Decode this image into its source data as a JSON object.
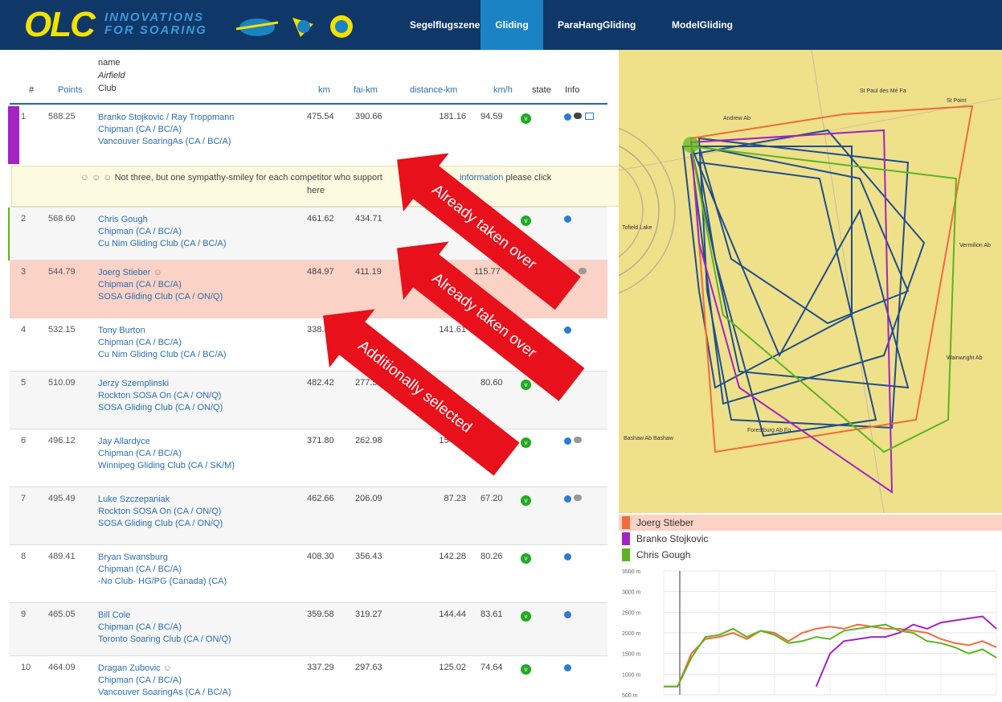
{
  "header": {
    "logo_text": "OLC",
    "tagline_1": "INNOVATIONS",
    "tagline_2": "FOR SOARING",
    "nav": [
      "Segelflugszene",
      "Gliding",
      "ParaHangGliding",
      "ModelGliding"
    ],
    "active_nav": "Gliding"
  },
  "table": {
    "col_rank": "#",
    "col_points": "Points",
    "col_name_1": "name",
    "col_name_2": "Airfield",
    "col_name_3": "Club",
    "col_km": "km",
    "col_fai": "fai-km",
    "col_dist": "distance-km",
    "col_kmh": "km/h",
    "col_state": "state",
    "col_info": "Info",
    "rows": [
      {
        "rank": "1",
        "points": "588.25",
        "name": "Branko Stojkovic / Ray Troppmann",
        "airfield": "Chipman (CA / BC/A)",
        "club": "Vancouver SoaringAs (CA / BC/A)",
        "km": "475.54",
        "fai": "390.66",
        "dist": "181.16",
        "kmh": "94.59"
      },
      {
        "rank": "2",
        "points": "568.60",
        "name": "Chris Gough",
        "airfield": "Chipman (CA / BC/A)",
        "club": "Cu Nim Gliding Club (CA / BC/A)",
        "km": "461.62",
        "fai": "434.71",
        "dist": "168",
        "kmh": ""
      },
      {
        "rank": "3",
        "points": "544.79",
        "name": "Joerg Stieber",
        "airfield": "Chipman (CA / BC/A)",
        "club": "SOSA Gliding Club (CA / ON/Q)",
        "km": "484.97",
        "fai": "411.19",
        "dist": "",
        "kmh": "115.77"
      },
      {
        "rank": "4",
        "points": "532.15",
        "name": "Tony Burton",
        "airfield": "Chipman (CA / BC/A)",
        "club": "Cu Nim Gliding Club (CA / BC/A)",
        "km": "338.49",
        "fai": "",
        "dist": "141.61",
        "kmh": ""
      },
      {
        "rank": "5",
        "points": "510.09",
        "name": "Jerzy Szemplinski",
        "airfield": "Rockton SOSA On (CA / ON/Q)",
        "club": "SOSA Gliding Club (CA / ON/Q)",
        "km": "482.42",
        "fai": "277.53",
        "dist": "",
        "kmh": "80.60"
      },
      {
        "rank": "6",
        "points": "496.12",
        "name": "Jay Allardyce",
        "airfield": "Chipman (CA / BC/A)",
        "club": "Winnipeg Gliding Club (CA / SK/M)",
        "km": "371.80",
        "fai": "262.98",
        "dist": "154.76",
        "kmh": ""
      },
      {
        "rank": "7",
        "points": "495.49",
        "name": "Luke Szczepaniak",
        "airfield": "Rockton SOSA On (CA / ON/Q)",
        "club": "SOSA Gliding Club (CA / ON/Q)",
        "km": "462.66",
        "fai": "206.09",
        "dist": "87.23",
        "kmh": "67.20"
      },
      {
        "rank": "8",
        "points": "489.41",
        "name": "Bryan Swansburg",
        "airfield": "Chipman (CA / BC/A)",
        "club": "-No Club- HG/PG (Canada) (CA)",
        "km": "408.30",
        "fai": "356.43",
        "dist": "142.28",
        "kmh": "80.26"
      },
      {
        "rank": "9",
        "points": "465.05",
        "name": "Bill Cole",
        "airfield": "Chipman (CA / BC/A)",
        "club": "Toronto Soaring Club (CA / ON/Q)",
        "km": "359.58",
        "fai": "319.27",
        "dist": "144.44",
        "kmh": "83.61"
      },
      {
        "rank": "10",
        "points": "464.09",
        "name": "Dragan Zubovic",
        "airfield": "Chipman (CA / BC/A)",
        "club": "Vancouver SoaringAs (CA / BC/A)",
        "km": "337.29",
        "fai": "297.63",
        "dist": "125.02",
        "kmh": "74.64"
      }
    ],
    "state_glyph": "v",
    "notice_prefix": "Not three, but one sympathy-smiley for each competitor who support",
    "notice_link": "information",
    "notice_suffix": "please click",
    "notice_tail": "here"
  },
  "annotations": {
    "arrow_1": "Already taken over",
    "arrow_2": "Already taken over",
    "arrow_3": "Additionally selected"
  },
  "map": {
    "places": [
      "St Paul des Mé Fa",
      "St Point",
      "Andrew Ab",
      "Vermilion Ab",
      "Wainwright Ab",
      "Bashaw Ab Bashaw",
      "Forestburg Ab Fo",
      "Tofield Lake"
    ],
    "colors": {
      "orange": "#f26b3a",
      "purple": "#a323c4",
      "green": "#5bb51f",
      "blue": "#1f4f8a"
    }
  },
  "legend": [
    {
      "name": "Joerg Stieber",
      "color": "#f26b3a"
    },
    {
      "name": "Branko Stojkovic",
      "color": "#a323c4"
    },
    {
      "name": "Chris Gough",
      "color": "#5bb51f"
    }
  ],
  "chart_data": {
    "type": "line",
    "ylabel": "",
    "ylim": [
      500,
      3500
    ],
    "yticks": [
      "3500 m",
      "3000 m",
      "2500 m",
      "2000 m",
      "1500 m",
      "1000 m",
      "500 m"
    ],
    "series": [
      {
        "name": "Joerg Stieber",
        "values": [
          700,
          700,
          1500,
          1850,
          1900,
          2000,
          1850,
          2050,
          2000,
          1800,
          2000,
          2100,
          2150,
          2100,
          2200,
          2150,
          2100,
          2100,
          2050,
          2000,
          1850,
          1750,
          1700,
          1800,
          1650
        ]
      },
      {
        "name": "Branko Stojkovic",
        "values": [
          null,
          null,
          null,
          null,
          null,
          null,
          null,
          null,
          null,
          null,
          null,
          700,
          1500,
          1800,
          1850,
          1900,
          1900,
          2000,
          2200,
          2100,
          2250,
          2300,
          2350,
          2400,
          2100
        ]
      },
      {
        "name": "Chris Gough",
        "values": [
          700,
          700,
          1400,
          1900,
          1950,
          2100,
          1900,
          2050,
          1950,
          1750,
          1800,
          1900,
          1850,
          2050,
          2100,
          2150,
          2200,
          2050,
          2000,
          1800,
          1750,
          1650,
          1500,
          1600,
          1400
        ]
      }
    ]
  }
}
